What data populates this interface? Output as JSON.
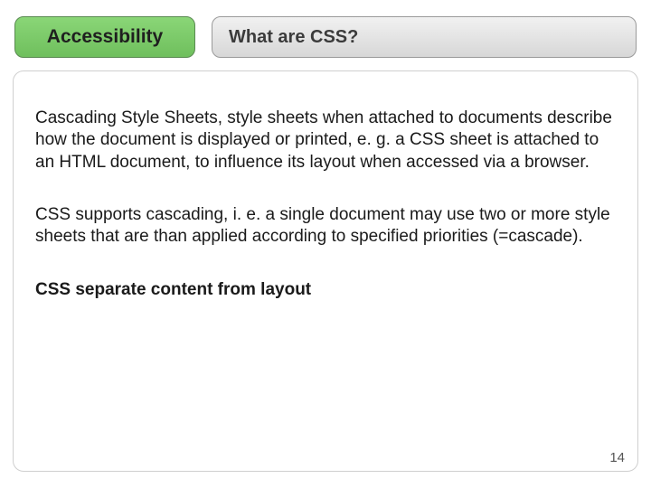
{
  "header": {
    "category_label": "Accessibility",
    "title": "What are CSS?"
  },
  "body": {
    "para1": "Cascading Style Sheets, style sheets when attached to documents describe how the document is displayed or printed, e. g. a CSS sheet is attached to an HTML document, to influence its layout when accessed via a browser.",
    "para2": "CSS supports cascading, i. e. a single document may use two or more style sheets that are than applied according to specified priorities (=cascade).",
    "para3": "CSS separate content from layout"
  },
  "page_number": "14"
}
